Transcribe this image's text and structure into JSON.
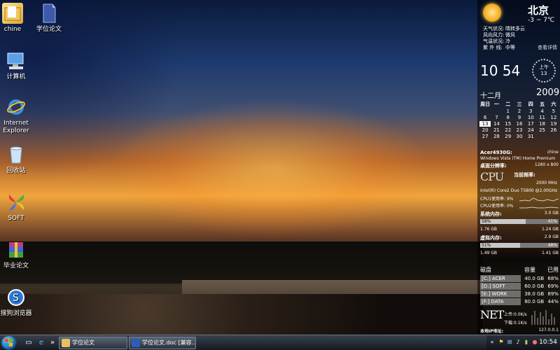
{
  "desktop": {
    "icons": [
      {
        "label": "chine",
        "icon": "folder-icon"
      },
      {
        "label": "学位论文",
        "icon": "document-icon"
      },
      {
        "label": "计算机",
        "icon": "computer-icon"
      },
      {
        "label": "Internet Explorer",
        "icon": "ie-icon"
      },
      {
        "label": "回收站",
        "icon": "recycle-bin-icon"
      },
      {
        "label": "SOFT",
        "icon": "soft-icon"
      },
      {
        "label": "毕业论文",
        "icon": "winrar-icon"
      },
      {
        "label": "搜狗浏览器",
        "icon": "sogou-icon"
      }
    ]
  },
  "weather": {
    "city": "北京",
    "temp": "-3 ~ 7℃",
    "rows": [
      {
        "k": "天气状况:",
        "v": "晴转多云"
      },
      {
        "k": "风向风力:",
        "v": "微风"
      },
      {
        "k": "气温状况:",
        "v": "冷"
      },
      {
        "k": "紫 外 线:",
        "v": "中等"
      }
    ],
    "more": "查看详情"
  },
  "clock": {
    "time": "10 54",
    "ampm": "上午",
    "day": "13"
  },
  "calendar": {
    "month": "十二月",
    "year": "2009",
    "headers": [
      "周日",
      "一",
      "二",
      "三",
      "四",
      "五",
      "六"
    ],
    "days": [
      "",
      "",
      "1",
      "2",
      "3",
      "4",
      "5",
      "6",
      "7",
      "8",
      "9",
      "10",
      "11",
      "12",
      "13",
      "14",
      "15",
      "16",
      "17",
      "18",
      "19",
      "20",
      "21",
      "22",
      "23",
      "24",
      "25",
      "26",
      "27",
      "28",
      "29",
      "30",
      "31",
      "",
      ""
    ],
    "today": "13"
  },
  "system": {
    "computer": "Acer4930G:",
    "user": "chine",
    "os": "Windows Vista (TM) Home Premium",
    "res_label": "桌面分辨率:",
    "res_value": "1280 x 800",
    "cpu_logo": "CPU",
    "freq_label": "当前频率:",
    "freq_value": "2000 MHz",
    "cpu_name": "Intel(R) Core2 Duo T5800 @2.00GHz",
    "cpu1": "CPU1使用率: 9%",
    "cpu2": "CPU2使用率: 0%",
    "mem_label": "系统内存:",
    "mem_total": "3.0 GB",
    "mem_used_pct": "58%",
    "mem_free_pct": "41%",
    "mem_used_fraction": 0.58,
    "mem_used": "1.76 GB",
    "mem_free": "1.24 GB",
    "vmem_label": "虚拟内存:",
    "vmem_total": "2.9 GB",
    "vmem_used_pct": "51%",
    "vmem_free_pct": "48%",
    "vmem_used_fraction": 0.51,
    "vmem_used": "1.49 GB",
    "vmem_free": "1.41 GB"
  },
  "disks": {
    "headers": [
      "磁盘",
      "容量",
      "已用"
    ],
    "rows": [
      {
        "name": "[C:] ACER",
        "size": "40.0 GB",
        "used": "68%"
      },
      {
        "name": "[D:] SOFT",
        "size": "60.0 GB",
        "used": "69%"
      },
      {
        "name": "[E:] WORK",
        "size": "38.0 GB",
        "used": "89%"
      },
      {
        "name": "[F:] DATA",
        "size": "80.0 GB",
        "used": "44%"
      }
    ]
  },
  "network": {
    "logo": "NET",
    "up": "上传:0.0K/s",
    "down": "下载:0.1K/s",
    "ip_label": "本地IP地址:",
    "ip": "127.0.0.1"
  },
  "taskbar": {
    "buttons": [
      {
        "label": "学位论文",
        "icon": "folder-icon"
      },
      {
        "label": "学位论文.doc [兼容...",
        "icon": "word-icon"
      }
    ],
    "time": "10:54"
  }
}
